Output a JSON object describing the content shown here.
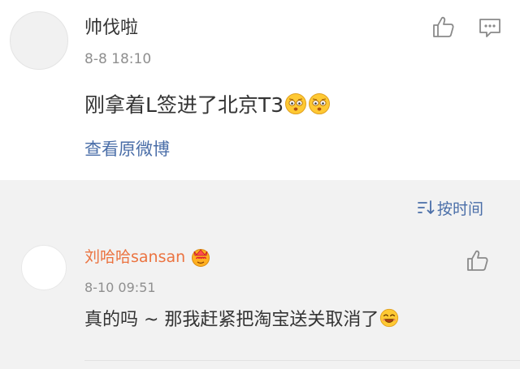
{
  "post": {
    "username": "帅伐啦",
    "time": "8-8 18:10",
    "content": "刚拿着L签进了北京T3",
    "content_emojis": [
      "scared-face-icon",
      "scared-face-icon"
    ],
    "view_original": "查看原微博",
    "actions": [
      "thumbs-up-icon",
      "comment-icon"
    ]
  },
  "sort": {
    "icon": "sort-icon",
    "label": "按时间"
  },
  "reply": {
    "username": "刘哈哈sansan",
    "badge_icon": "crown-badge-icon",
    "time": "8-10 09:51",
    "content": "真的吗 ~ 那我赶紧把淘宝送关取消了",
    "content_emoji": "laughing-face-icon",
    "action": "thumbs-up-icon"
  },
  "colors": {
    "background": "#f2f2f2",
    "card": "#ffffff",
    "link": "#4a6ea8",
    "reply_username": "#eb7340",
    "text": "#333333",
    "muted": "#8f8f8f"
  }
}
